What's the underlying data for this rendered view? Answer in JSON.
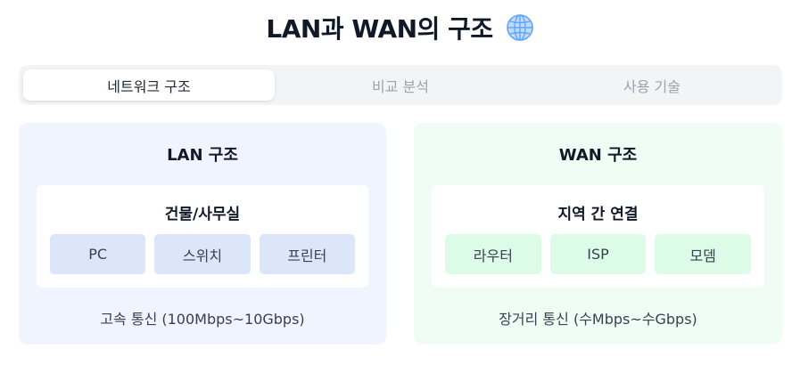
{
  "header": {
    "title": "LAN과 WAN의 구조",
    "icon": "globe-icon"
  },
  "tabs": [
    {
      "label": "네트워크 구조",
      "active": true
    },
    {
      "label": "비교 분석",
      "active": false
    },
    {
      "label": "사용 기술",
      "active": false
    }
  ],
  "lan": {
    "title": "LAN 구조",
    "inner_title": "건물/사무실",
    "chips": [
      "PC",
      "스위치",
      "프린터"
    ],
    "footer": "고속 통신 (100Mbps~10Gbps)"
  },
  "wan": {
    "title": "WAN 구조",
    "inner_title": "지역 간 연결",
    "chips": [
      "라우터",
      "ISP",
      "모뎀"
    ],
    "footer": "장거리 통신 (수Mbps~수Gbps)"
  },
  "colors": {
    "lan_card": "#eff4fe",
    "lan_chip": "#dbe6fb",
    "wan_card": "#f0fdf4",
    "wan_chip": "#dcfce7",
    "tabbar": "#f3f4f6"
  }
}
